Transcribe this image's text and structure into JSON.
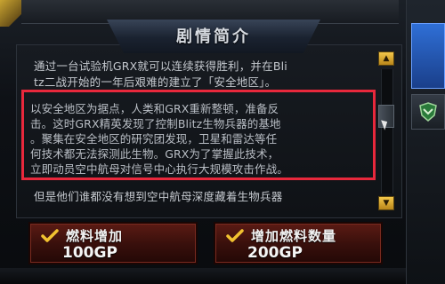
{
  "panel": {
    "title": "剧情简介",
    "intro_lines": [
      "通过一台试验机GRX就可以连续获得胜利，并在Bli",
      "tz二战开始的一年后艰难的建立了「安全地区」。"
    ],
    "highlight_lines": [
      "以安全地区为据点，人类和GRX重新整顿，准备反",
      "击。这时GRX精英发现了控制Blitz生物兵器的基地",
      "。聚集在安全地区的研究团发现，卫星和雷达等任",
      "何技术都无法探测此生物。GRX为了掌握此技术，",
      "立即动员空中航母对信号中心执行大规模攻击作战。"
    ],
    "tail_line": "但是他们谁都没有想到空中航母深度藏着生物兵器"
  },
  "buttons": [
    {
      "label": "燃料增加",
      "price": "100GP"
    },
    {
      "label": "增加燃料数量",
      "price": "200GP"
    }
  ],
  "icons": {
    "scroll_up": "triangle-up-icon",
    "scroll_down": "triangle-down-icon",
    "check": "check-icon",
    "shield": "shield-icon"
  },
  "colors": {
    "highlight_border": "#e8283c",
    "button_bg": "#3a100c",
    "check": "#f2c230",
    "right_button": "#2f6fd6"
  }
}
